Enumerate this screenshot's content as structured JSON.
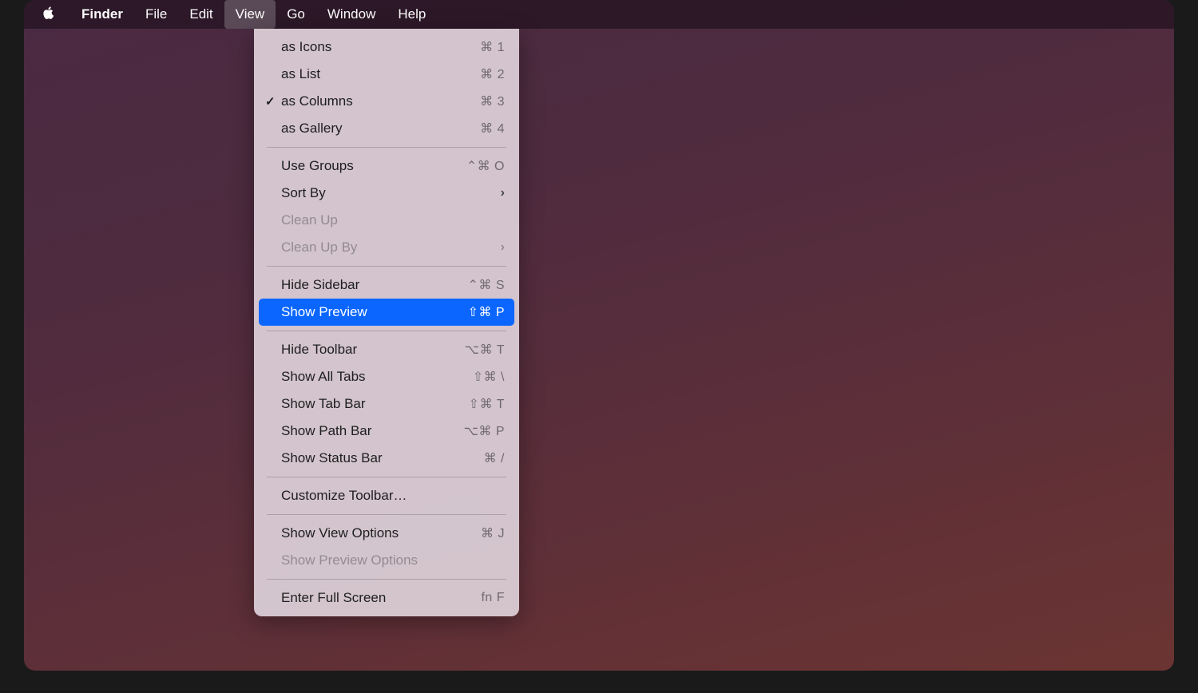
{
  "menubar": {
    "app": "Finder",
    "items": [
      "File",
      "Edit",
      "View",
      "Go",
      "Window",
      "Help"
    ],
    "activeIndex": 2
  },
  "dropdown": {
    "groups": [
      [
        {
          "label": "as Icons",
          "shortcut": "⌘ 1",
          "checked": false
        },
        {
          "label": "as List",
          "shortcut": "⌘ 2",
          "checked": false
        },
        {
          "label": "as Columns",
          "shortcut": "⌘ 3",
          "checked": true
        },
        {
          "label": "as Gallery",
          "shortcut": "⌘ 4",
          "checked": false
        }
      ],
      [
        {
          "label": "Use Groups",
          "shortcut": "⌃⌘ O"
        },
        {
          "label": "Sort By",
          "submenu": true
        },
        {
          "label": "Clean Up",
          "disabled": true
        },
        {
          "label": "Clean Up By",
          "submenu": true,
          "disabled": true
        }
      ],
      [
        {
          "label": "Hide Sidebar",
          "shortcut": "⌃⌘ S"
        },
        {
          "label": "Show Preview",
          "shortcut": "⇧⌘ P",
          "highlighted": true
        }
      ],
      [
        {
          "label": "Hide Toolbar",
          "shortcut": "⌥⌘ T"
        },
        {
          "label": "Show All Tabs",
          "shortcut": "⇧⌘ \\"
        },
        {
          "label": "Show Tab Bar",
          "shortcut": "⇧⌘ T"
        },
        {
          "label": "Show Path Bar",
          "shortcut": "⌥⌘ P"
        },
        {
          "label": "Show Status Bar",
          "shortcut": "⌘ /"
        }
      ],
      [
        {
          "label": "Customize Toolbar…"
        }
      ],
      [
        {
          "label": "Show View Options",
          "shortcut": "⌘ J"
        },
        {
          "label": "Show Preview Options",
          "disabled": true
        }
      ],
      [
        {
          "label": "Enter Full Screen",
          "shortcut": "fn F"
        }
      ]
    ]
  }
}
